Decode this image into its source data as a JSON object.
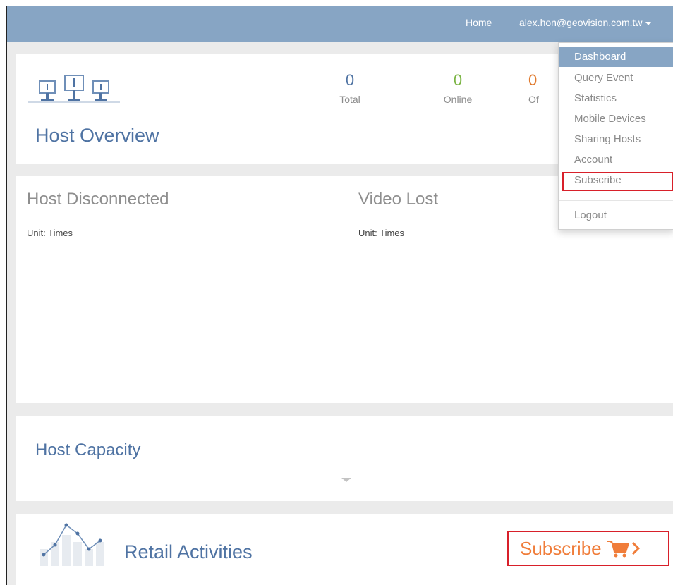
{
  "topbar": {
    "home": "Home",
    "user": "alex.hon@geovision.com.tw"
  },
  "overview": {
    "title": "Host Overview",
    "stats": [
      {
        "value": "0",
        "label": "Total"
      },
      {
        "value": "0",
        "label": "Online"
      },
      {
        "value": "0",
        "label": "Of"
      }
    ]
  },
  "charts": {
    "host_disconnected": {
      "title": "Host Disconnected",
      "unit": "Unit: Times"
    },
    "video_lost": {
      "title": "Video Lost",
      "unit": "Unit: Times"
    }
  },
  "capacity": {
    "title": "Host Capacity"
  },
  "retail": {
    "title": "Retail Activities",
    "subscribe": "Subscribe"
  },
  "menu": {
    "items": [
      {
        "label": "Dashboard",
        "active": true
      },
      {
        "label": "Query Event"
      },
      {
        "label": "Statistics"
      },
      {
        "label": "Mobile Devices"
      },
      {
        "label": "Sharing Hosts"
      },
      {
        "label": "Account"
      },
      {
        "label": "Subscribe"
      },
      {
        "label": "Logout"
      }
    ]
  },
  "colors": {
    "topbar": "#87a5c4",
    "title_blue": "#4f73a3",
    "online_green": "#7ab443",
    "subscribe_orange": "#f07d3a",
    "highlight_red": "#d8202a"
  },
  "icons": [
    "hosts-icon",
    "caret-down-icon",
    "chevron-down-icon",
    "retail-chart-icon",
    "cart-icon",
    "chevron-right-icon"
  ]
}
